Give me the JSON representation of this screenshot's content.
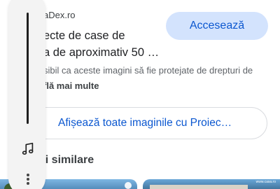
{
  "result": {
    "source": "aDex.ro",
    "title_lines": [
      "ecte de case de",
      "a de aproximativ 50 …"
    ],
    "visit_button": "Accesează",
    "notice": "sibil ca aceste imagini să fie protejate de drepturi de",
    "learn_more": "flă mai multe"
  },
  "show_all_button": "Afișează toate imaginile cu Proiec…",
  "similar_heading": "ni similare",
  "thumbnails": {
    "second_watermark": "www.casa.ro"
  },
  "side_panel": {
    "icons": [
      "volume-slider",
      "music-note-icon",
      "more-vert-icon"
    ]
  }
}
